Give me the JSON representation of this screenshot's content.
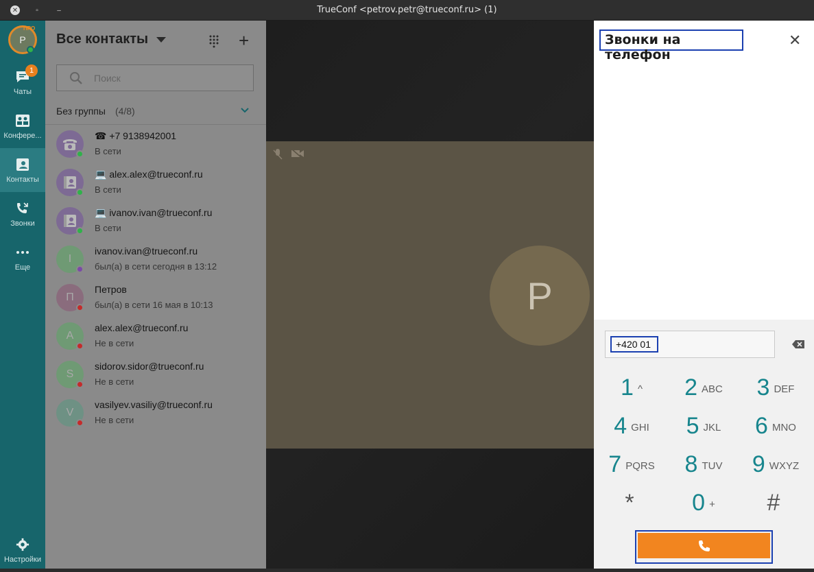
{
  "window": {
    "title": "TrueConf <petrov.petr@trueconf.ru> (1)"
  },
  "rail": {
    "avatar_letter": "P",
    "pro_badge": "ПРО",
    "chats_badge": "1",
    "items": [
      {
        "label": "Чаты"
      },
      {
        "label": "Конфере..."
      },
      {
        "label": "Контакты"
      },
      {
        "label": "Звонки"
      },
      {
        "label": "Еще"
      }
    ],
    "settings_label": "Настройки"
  },
  "contacts": {
    "header": "Все контакты",
    "search_placeholder": "Поиск",
    "group": {
      "name": "Без группы",
      "count": "(4/8)"
    },
    "list": [
      {
        "name": "☎ +7 9138942001",
        "status": "В сети",
        "status_color": "#2fb24a",
        "avatar": "phone"
      },
      {
        "name": "💻 alex.alex@trueconf.ru",
        "status": "В сети",
        "status_color": "#2fb24a",
        "avatar": "contact"
      },
      {
        "name": "💻 ivanov.ivan@trueconf.ru",
        "status": "В сети",
        "status_color": "#2fb24a",
        "avatar": "contact"
      },
      {
        "name": "ivanov.ivan@trueconf.ru",
        "status": "был(а) в сети сегодня в 13:12",
        "status_color": "#7b4aa8",
        "avatar_letter": "I",
        "avatar_bg": "#6f9a74"
      },
      {
        "name": "Петров",
        "status": "был(а) в сети 16 мая в 10:13",
        "status_color": "#c42b2b",
        "avatar_letter": "П",
        "avatar_bg": "#8a6c7d"
      },
      {
        "name": "alex.alex@trueconf.ru",
        "status": "Не в сети",
        "status_color": "#c42b2b",
        "avatar_letter": "A",
        "avatar_bg": "#6f9a74"
      },
      {
        "name": "sidorov.sidor@trueconf.ru",
        "status": "Не в сети",
        "status_color": "#c42b2b",
        "avatar_letter": "S",
        "avatar_bg": "#6f9a74"
      },
      {
        "name": "vasilyev.vasiliy@trueconf.ru",
        "status": "Не в сети",
        "status_color": "#c42b2b",
        "avatar_letter": "V",
        "avatar_bg": "#6e9184"
      }
    ]
  },
  "video": {
    "peer_letter": "P"
  },
  "panel": {
    "title": "Звонки на телефон",
    "number": "+420 01",
    "keys": [
      {
        "digit": "1",
        "letters": "^"
      },
      {
        "digit": "2",
        "letters": "ABC"
      },
      {
        "digit": "3",
        "letters": "DEF"
      },
      {
        "digit": "4",
        "letters": "GHI"
      },
      {
        "digit": "5",
        "letters": "JKL"
      },
      {
        "digit": "6",
        "letters": "MNO"
      },
      {
        "digit": "7",
        "letters": "PQRS"
      },
      {
        "digit": "8",
        "letters": "TUV"
      },
      {
        "digit": "9",
        "letters": "WXYZ"
      },
      {
        "digit": "*",
        "letters": ""
      },
      {
        "digit": "0",
        "letters": "+"
      },
      {
        "digit": "#",
        "letters": ""
      }
    ],
    "accent": "#f2851f",
    "digit_color": "#17858d"
  }
}
